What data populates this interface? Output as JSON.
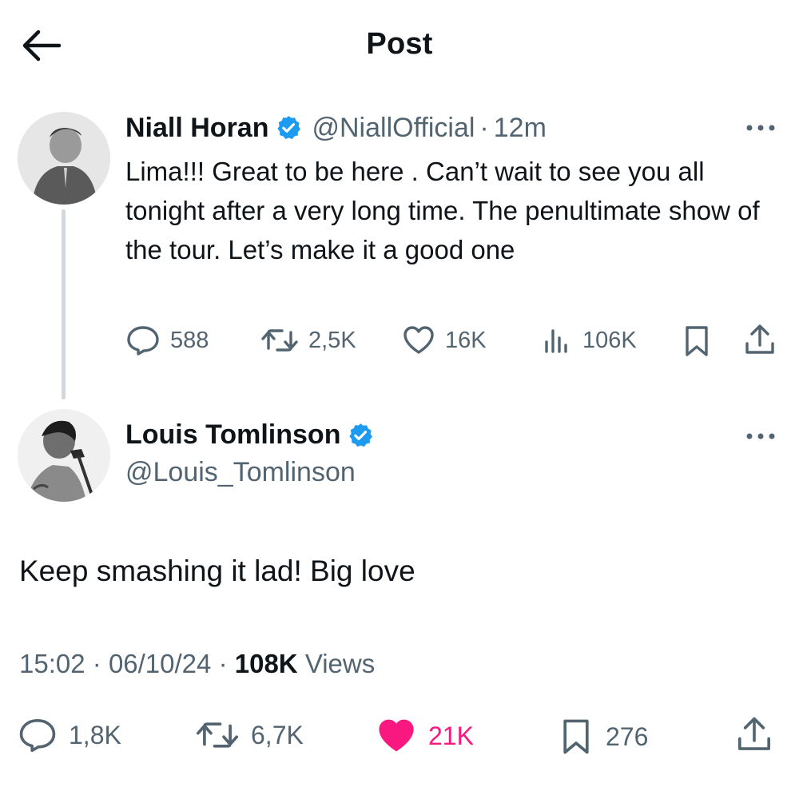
{
  "header": {
    "title": "Post"
  },
  "parent_post": {
    "author_name": "Niall Horan",
    "handle": "@NiallOfficial",
    "separator": "·",
    "time": "12m",
    "text": "Lima!!! Great to be here . Can’t wait to see you all tonight after a very long time. The penultimate show of the tour. Let’s make it a good one",
    "stats": {
      "replies": "588",
      "reposts": "2,5K",
      "likes": "16K",
      "views": "106K"
    }
  },
  "reply_post": {
    "author_name": "Louis Tomlinson",
    "handle": "@Louis_Tomlinson",
    "text": "Keep smashing it lad! Big love",
    "time": "15:02",
    "separator": "·",
    "date": "06/10/24",
    "views_count": "108K",
    "views_label": "Views",
    "stats": {
      "replies": "1,8K",
      "reposts": "6,7K",
      "likes": "21K",
      "bookmarks": "276"
    },
    "liked": true
  },
  "colors": {
    "text_primary": "#0f1419",
    "text_secondary": "#536471",
    "verified": "#1d9bf0",
    "like_active": "#f91880",
    "thread_line": "#cfd9de"
  },
  "icons": [
    "back-arrow-icon",
    "verified-badge-icon",
    "more-icon",
    "reply-icon",
    "repost-icon",
    "like-icon",
    "views-icon",
    "bookmark-icon",
    "share-icon"
  ]
}
